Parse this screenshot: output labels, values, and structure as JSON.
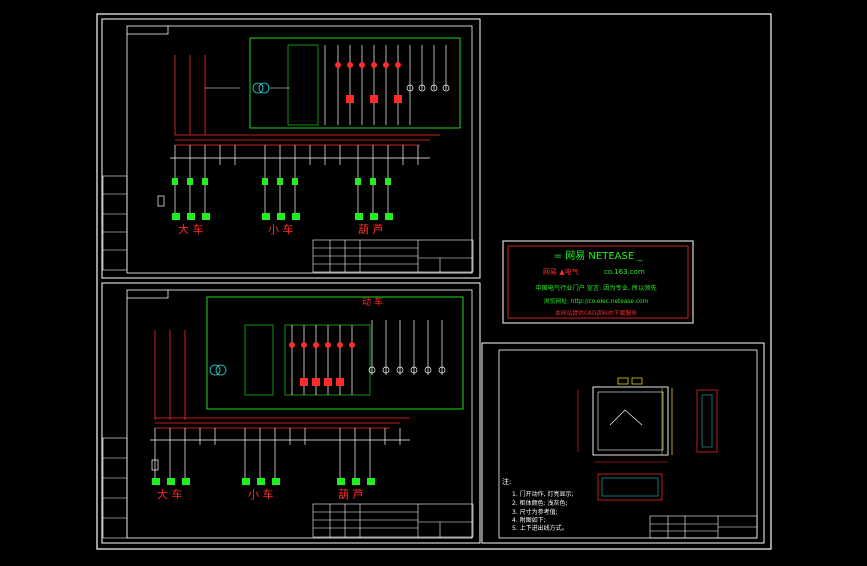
{
  "drawing": {
    "colors": {
      "background": "#000000",
      "sheet": "#ffffff",
      "red": "#ff2a2a",
      "green": "#22ee22",
      "yellow": "#ffee00",
      "cyan": "#20e0e0"
    },
    "top_panel": {
      "labels": {
        "da_che": "大 车",
        "xiao_che": "小 车",
        "hu_lu": "葫 芦"
      }
    },
    "bottom_panel": {
      "labels": {
        "da_che": "大 车",
        "xiao_che": "小 车",
        "hu_lu": "葫 芦"
      },
      "header": "动 车"
    },
    "watermark": {
      "title": "= 网易  NETEASE _",
      "line1a": "网易 ▲电气",
      "line1b": "co.163.com",
      "line2": "中国电气行业门户 宣言: 因为专业, 所以领先",
      "line3": "浏览网址: http://co.elec.netease.com",
      "line4": "本网站提供CAD资料的下载服务"
    },
    "notes": {
      "title": "注:",
      "items": [
        "1. 门开动作, 灯亮显示;",
        "2. 柜体颜色: 浅灰色;",
        "3. 尺寸为参考值;",
        "4. 附图如下;",
        "5. 上下进出线方式。"
      ]
    }
  }
}
